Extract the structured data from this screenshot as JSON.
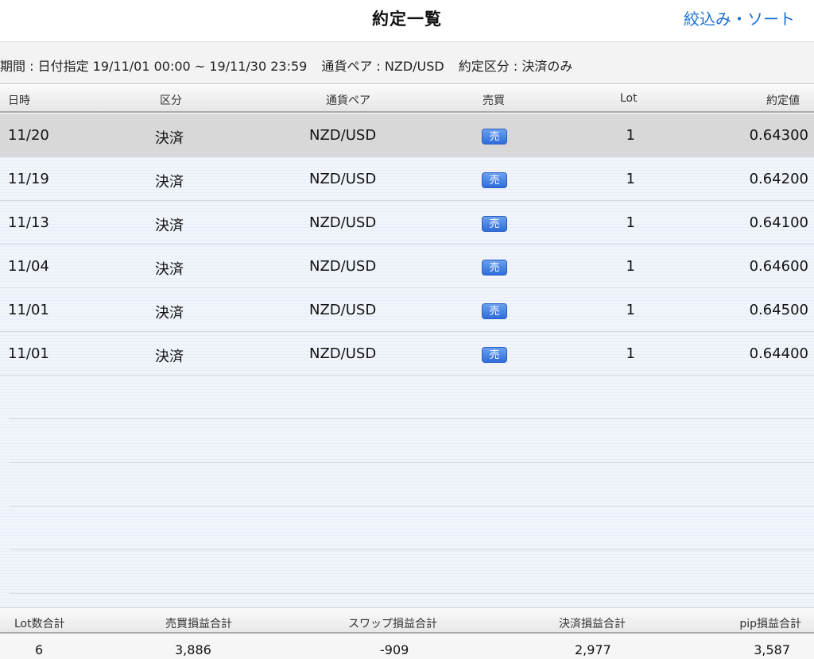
{
  "header": {
    "title": "約定一覧",
    "filter_sort_label": "絞込み・ソート"
  },
  "filter": {
    "period": "期間 : 日付指定 19/11/01 00:00 ~ 19/11/30 23:59",
    "pair": "通貨ペア : NZD/USD",
    "kind": "約定区分 : 決済のみ"
  },
  "table": {
    "columns": [
      "日時",
      "区分",
      "通貨ペア",
      "売買",
      "Lot",
      "約定値"
    ],
    "rows": [
      {
        "date": "11/20",
        "kind": "決済",
        "pair": "NZD/USD",
        "side": "売",
        "lot": "1",
        "price": "0.64300"
      },
      {
        "date": "11/19",
        "kind": "決済",
        "pair": "NZD/USD",
        "side": "売",
        "lot": "1",
        "price": "0.64200"
      },
      {
        "date": "11/13",
        "kind": "決済",
        "pair": "NZD/USD",
        "side": "売",
        "lot": "1",
        "price": "0.64100"
      },
      {
        "date": "11/04",
        "kind": "決済",
        "pair": "NZD/USD",
        "side": "売",
        "lot": "1",
        "price": "0.64600"
      },
      {
        "date": "11/01",
        "kind": "決済",
        "pair": "NZD/USD",
        "side": "売",
        "lot": "1",
        "price": "0.64500"
      },
      {
        "date": "11/01",
        "kind": "決済",
        "pair": "NZD/USD",
        "side": "売",
        "lot": "1",
        "price": "0.64400"
      }
    ],
    "selected_index": 0
  },
  "summary": {
    "labels": [
      "Lot数合計",
      "売買損益合計",
      "スワップ損益合計",
      "決済損益合計",
      "pip損益合計"
    ],
    "values": [
      "6",
      "3,886",
      "-909",
      "2,977",
      "3,587"
    ]
  },
  "colors": {
    "accent": "#1a6fd6",
    "sell_badge": "#2f6ddc",
    "selected_row": "#d8d8d8"
  }
}
